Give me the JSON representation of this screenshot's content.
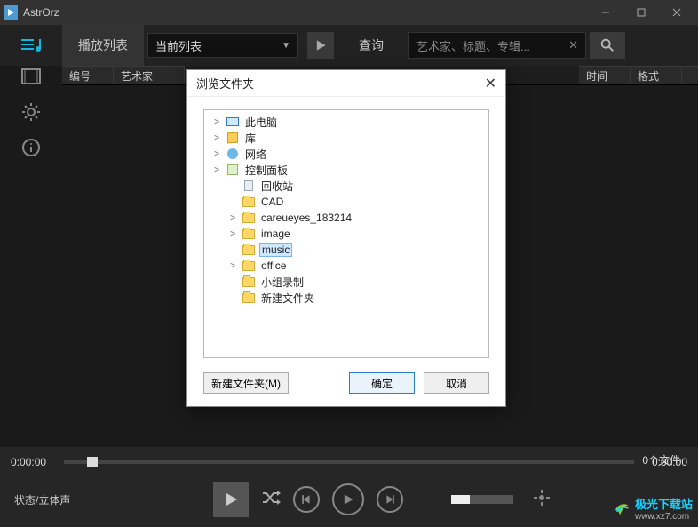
{
  "app": {
    "title": "AstrOrz"
  },
  "toolbar": {
    "playlist_label": "播放列表",
    "combo_value": "当前列表",
    "query_label": "查询",
    "search_placeholder": "艺术家、标题、专辑..."
  },
  "table_headers": {
    "index": "编号",
    "artist": "艺术家",
    "time": "时间",
    "format": "格式"
  },
  "player": {
    "time_left": "0:00:00",
    "time_right": "0:00:00",
    "status": "状态/立体声",
    "filecount": "0个文件"
  },
  "watermark": {
    "brand": "极光下载站",
    "url": "www.xz7.com"
  },
  "dialog": {
    "title": "浏览文件夹",
    "btn_new": "新建文件夹(M)",
    "btn_ok": "确定",
    "btn_cancel": "取消",
    "tree": [
      {
        "label": "此电脑",
        "icon": "pc",
        "expander": true,
        "indent": 0
      },
      {
        "label": "库",
        "icon": "lib",
        "expander": true,
        "indent": 0
      },
      {
        "label": "网络",
        "icon": "net",
        "expander": true,
        "indent": 0
      },
      {
        "label": "控制面板",
        "icon": "cp",
        "expander": true,
        "indent": 0
      },
      {
        "label": "回收站",
        "icon": "rb",
        "expander": false,
        "indent": 1
      },
      {
        "label": "CAD",
        "icon": "fold",
        "expander": false,
        "indent": 1
      },
      {
        "label": "careueyes_183214",
        "icon": "fold",
        "expander": true,
        "indent": 1
      },
      {
        "label": "image",
        "icon": "fold",
        "expander": true,
        "indent": 1
      },
      {
        "label": "music",
        "icon": "fold",
        "expander": false,
        "indent": 1,
        "selected": true
      },
      {
        "label": "office",
        "icon": "fold",
        "expander": true,
        "indent": 1
      },
      {
        "label": "小组录制",
        "icon": "fold",
        "expander": false,
        "indent": 1
      },
      {
        "label": "新建文件夹",
        "icon": "fold",
        "expander": false,
        "indent": 1
      }
    ]
  }
}
